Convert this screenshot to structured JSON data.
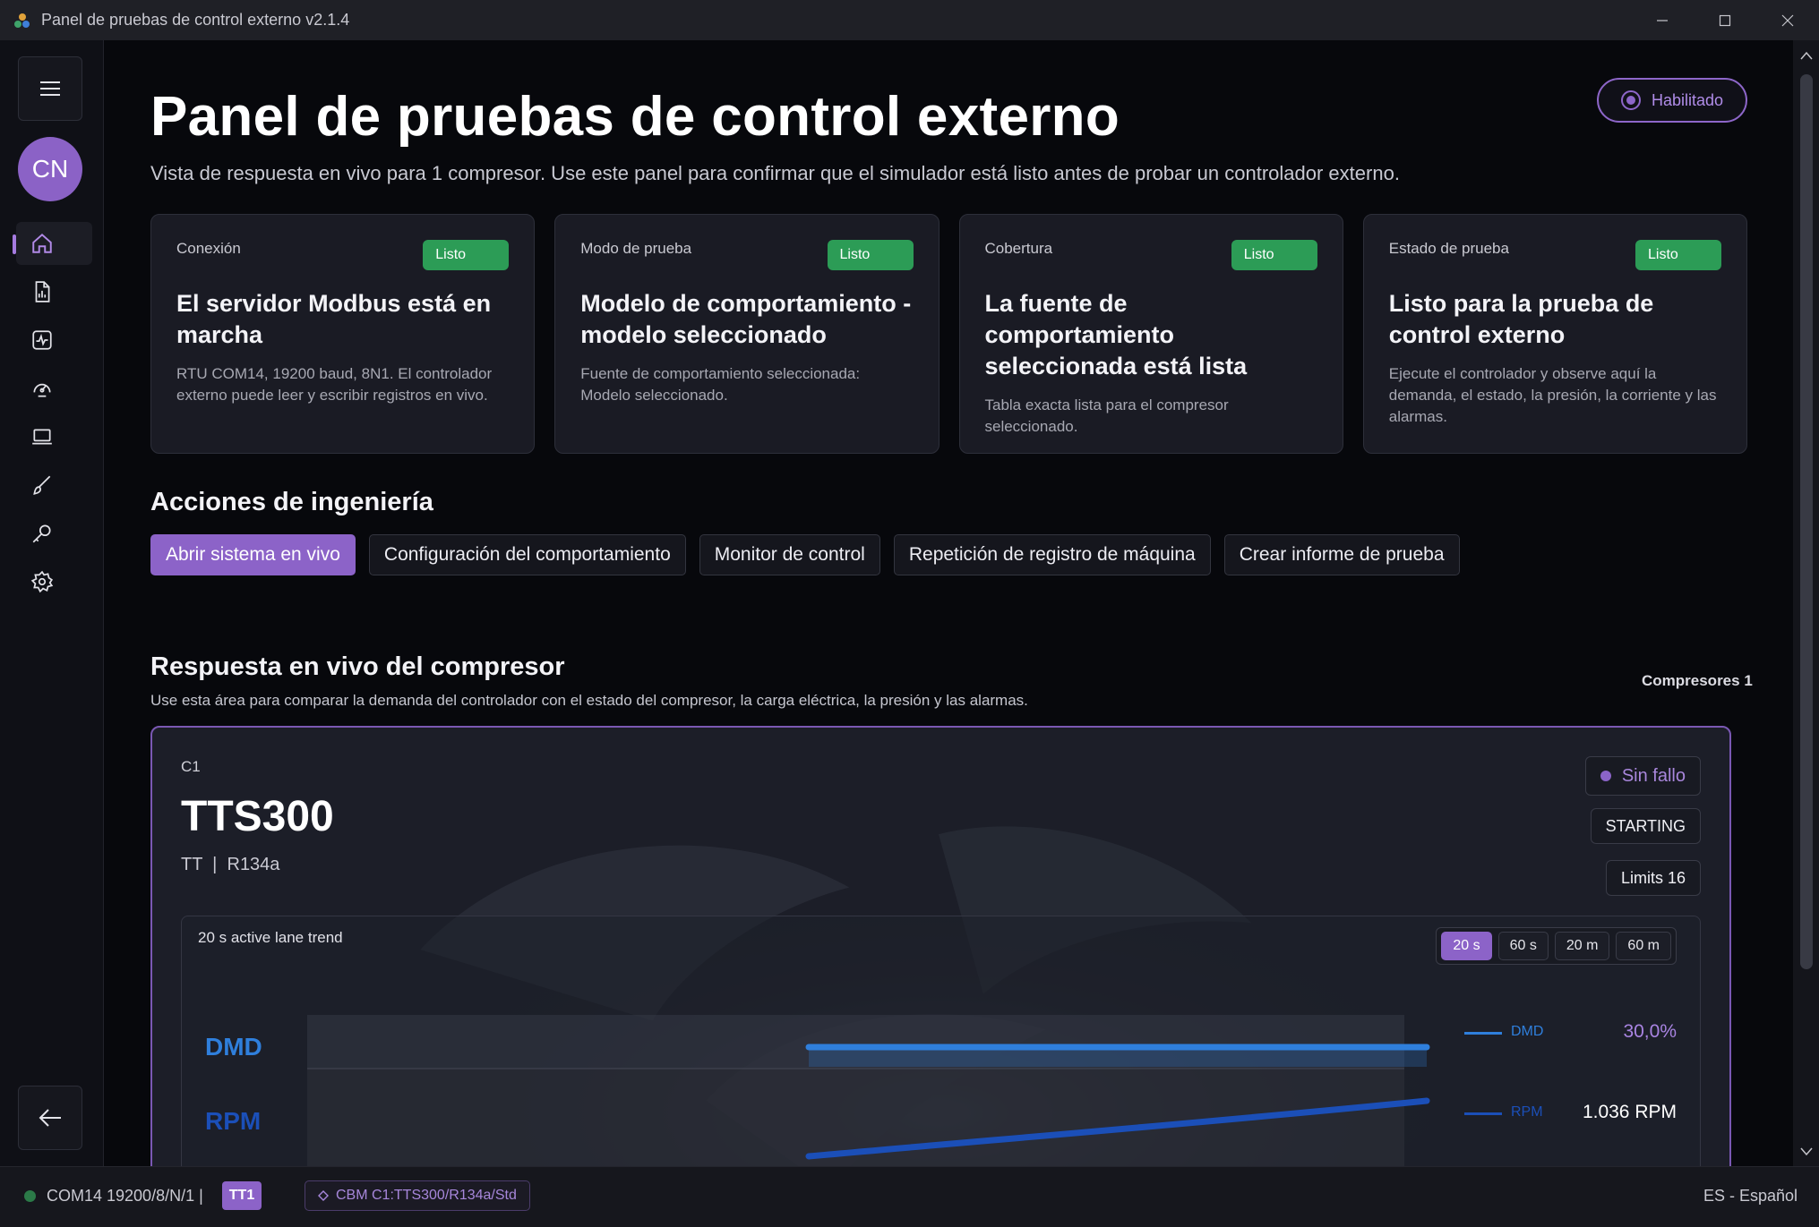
{
  "window": {
    "title": "Panel de pruebas de control externo v2.1.4"
  },
  "sidebar": {
    "avatar_initials": "CN",
    "nav_items": [
      {
        "icon": "home-icon",
        "active": true
      },
      {
        "icon": "report-icon",
        "active": false
      },
      {
        "icon": "activity-icon",
        "active": false
      },
      {
        "icon": "gauge-icon",
        "active": false
      },
      {
        "icon": "laptop-icon",
        "active": false
      },
      {
        "icon": "brush-icon",
        "active": false
      },
      {
        "icon": "key-icon",
        "active": false
      },
      {
        "icon": "settings-icon",
        "active": false
      }
    ]
  },
  "header": {
    "title": "Panel de pruebas de control externo",
    "subtitle": "Vista de respuesta en vivo para 1 compresor. Use este panel para confirmar que el simulador está listo antes de probar un controlador externo.",
    "enabled_label": "Habilitado"
  },
  "status_cards": [
    {
      "label": "Conexión",
      "badge": "Listo",
      "heading": "El servidor Modbus está en marcha",
      "description": "RTU COM14, 19200 baud, 8N1. El controlador externo puede leer y escribir registros en vivo."
    },
    {
      "label": "Modo de prueba",
      "badge": "Listo",
      "heading": "Modelo de comportamiento - modelo seleccionado",
      "description": "Fuente de comportamiento seleccionada: Modelo seleccionado."
    },
    {
      "label": "Cobertura",
      "badge": "Listo",
      "heading": "La fuente de comportamiento seleccionada está lista",
      "description": "Tabla exacta lista para el compresor seleccionado."
    },
    {
      "label": "Estado de prueba",
      "badge": "Listo",
      "heading": "Listo para la prueba de control externo",
      "description": "Ejecute el controlador y observe aquí la demanda, el estado, la presión, la corriente y las alarmas."
    }
  ],
  "engineering": {
    "title": "Acciones de ingeniería",
    "actions": [
      "Abrir sistema en vivo",
      "Configuración del comportamiento",
      "Monitor de control",
      "Repetición de registro de máquina",
      "Crear informe de prueba"
    ]
  },
  "live_response": {
    "title": "Respuesta en vivo del compresor",
    "description": "Use esta área para comparar la demanda del controlador con el estado del compresor, la carga eléctrica, la presión y las alarmas.",
    "compressor_count": "Compresores 1"
  },
  "compressor": {
    "id": "C1",
    "model": "TTS300",
    "meta": "TT  |  R134a",
    "fault": "Sin fallo",
    "state": "STARTING",
    "limits": "Limits 16"
  },
  "trend": {
    "title": "20 s active lane trend",
    "ranges": [
      "20 s",
      "60 s",
      "20 m",
      "60 m"
    ],
    "active_range": "20 s",
    "colors": {
      "dmd": "#2f7fdc",
      "rpm": "#1b4fb8",
      "accent": "#8c63c8"
    },
    "lanes": [
      {
        "label": "DMD",
        "legend": "DMD",
        "value": "30,0%"
      },
      {
        "label": "RPM",
        "legend": "RPM",
        "value": "1.036 RPM"
      }
    ]
  },
  "statusbar": {
    "port": "COM14 19200/8/N/1  |",
    "tt_badge": "TT1",
    "cbm": "CBM C1:TTS300/R134a/Std",
    "language": "ES - Español"
  }
}
